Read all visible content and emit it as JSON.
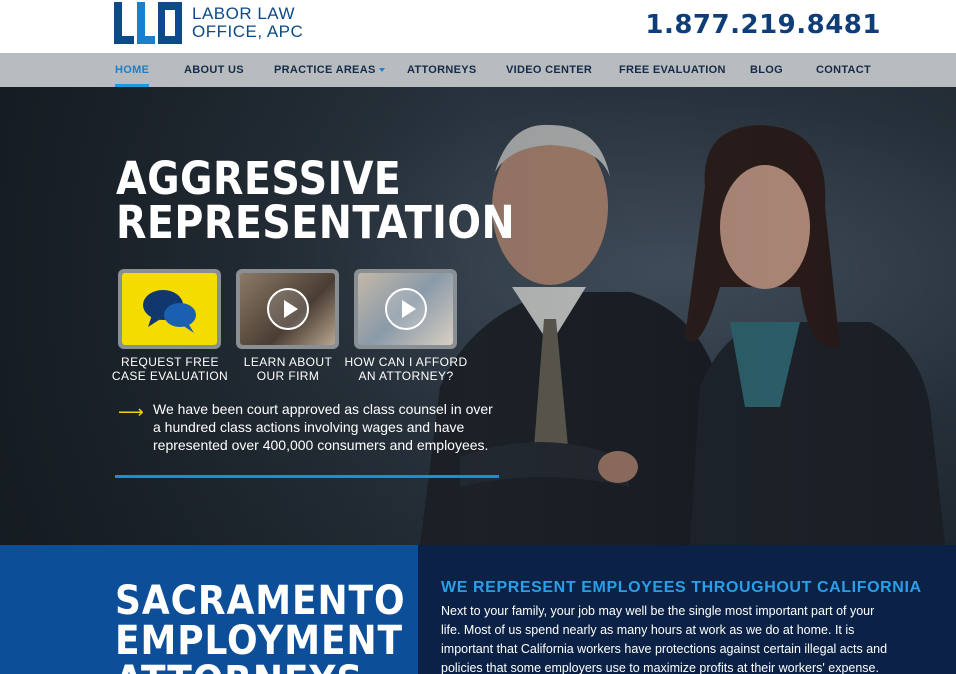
{
  "header": {
    "logo_line1": "LABOR LAW",
    "logo_line2": "OFFICE, APC",
    "phone": "1.877.219.8481"
  },
  "nav": {
    "items": [
      {
        "label": "HOME"
      },
      {
        "label": "ABOUT US"
      },
      {
        "label": "PRACTICE AREAS"
      },
      {
        "label": "ATTORNEYS"
      },
      {
        "label": "VIDEO CENTER"
      },
      {
        "label": "FREE EVALUATION"
      },
      {
        "label": "BLOG"
      },
      {
        "label": "CONTACT"
      }
    ]
  },
  "hero": {
    "title_line1": "AGGRESSIVE",
    "title_line2": "REPRESENTATION",
    "tiles": [
      {
        "label_line1": "REQUEST FREE",
        "label_line2": "CASE EVALUATION",
        "icon": "chat-bubbles-icon"
      },
      {
        "label_line1": "LEARN ABOUT",
        "label_line2": "OUR FIRM",
        "icon": "play-icon"
      },
      {
        "label_line1": "HOW CAN I AFFORD",
        "label_line2": "AN ATTORNEY?",
        "icon": "play-icon"
      }
    ],
    "arrow": "⟶",
    "statement": "We have been court approved as class counsel in over a hundred class actions involving wages and have represented over 400,000 consumers and employees."
  },
  "bottom": {
    "title_line1": "SACRAMENTO",
    "title_line2": "EMPLOYMENT",
    "title_line3": "ATTORNEYS",
    "heading": "WE REPRESENT EMPLOYEES THROUGHOUT CALIFORNIA",
    "paragraph": "Next to your family, your job may well be the single most important part of your life. Most of us spend nearly as many hours at work as we do at home. It is important that California workers have protections against certain illegal acts and policies that some employers use to maximize profits at their workers' expense."
  },
  "colors": {
    "brand_blue": "#0c4f98",
    "accent_blue": "#1b9ae0",
    "navy": "#0b2246",
    "yellow": "#f5dc00"
  }
}
